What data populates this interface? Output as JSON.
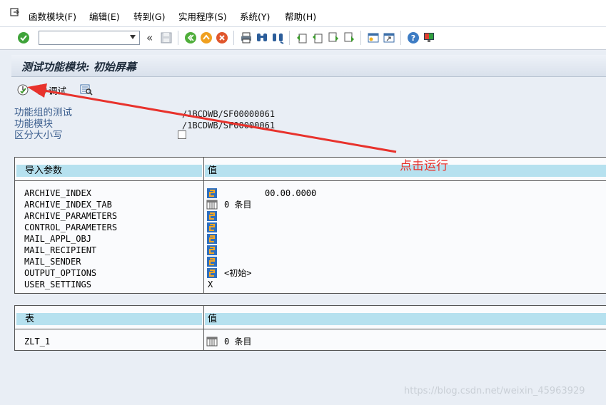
{
  "menu": {
    "items": [
      "函数模块(F)",
      "编辑(E)",
      "转到(G)",
      "实用程序(S)",
      "系统(Y)",
      "帮助(H)"
    ]
  },
  "toolbar": {
    "command_value": "",
    "icons": [
      "enter-icon",
      "save-icon",
      "back-icon",
      "exit-icon",
      "cancel-icon",
      "print-icon",
      "find-icon",
      "find-next-icon",
      "first-page-icon",
      "previous-page-icon",
      "next-page-icon",
      "last-page-icon",
      "create-session-icon",
      "shortcut-icon",
      "help-icon",
      "customize-layout-icon"
    ]
  },
  "screen": {
    "title": "测试功能模块: 初始屏幕"
  },
  "app_toolbar": {
    "debug_label": "调试"
  },
  "fields": {
    "group_label": "功能组的测试",
    "group_value": "/1BCDWB/SF00000061",
    "module_label": "功能模块",
    "module_value": "/1BCDWB/SF00000061",
    "case_label": "区分大小写",
    "case_checked": false
  },
  "import_table": {
    "col_param": "导入参数",
    "col_value": "值",
    "rows": [
      {
        "name": "ARCHIVE_INDEX",
        "value": "00.00.0000",
        "icon": "structure-icon"
      },
      {
        "name": "ARCHIVE_INDEX_TAB",
        "value": "0 条目",
        "icon": "table-icon"
      },
      {
        "name": "ARCHIVE_PARAMETERS",
        "value": "",
        "icon": "structure-icon"
      },
      {
        "name": "CONTROL_PARAMETERS",
        "value": "",
        "icon": "structure-icon"
      },
      {
        "name": "MAIL_APPL_OBJ",
        "value": "",
        "icon": "structure-icon"
      },
      {
        "name": "MAIL_RECIPIENT",
        "value": "",
        "icon": "structure-icon"
      },
      {
        "name": "MAIL_SENDER",
        "value": "",
        "icon": "structure-icon"
      },
      {
        "name": "OUTPUT_OPTIONS",
        "value": "<初始>",
        "icon": "structure-icon"
      },
      {
        "name": "USER_SETTINGS",
        "value": "X",
        "icon": ""
      }
    ]
  },
  "tables_table": {
    "col_param": "表",
    "col_value": "值",
    "rows": [
      {
        "name": "ZLT_1",
        "value": "0 条目",
        "icon": "table-icon"
      }
    ]
  },
  "annotation": {
    "text": "点击运行",
    "color": "#e8322c"
  },
  "watermark": "https://blog.csdn.net/weixin_45963929",
  "colors": {
    "header_bg": "#b6e1ef",
    "label_blue": "#3b5e8e",
    "page_bg": "#e9eef5"
  }
}
